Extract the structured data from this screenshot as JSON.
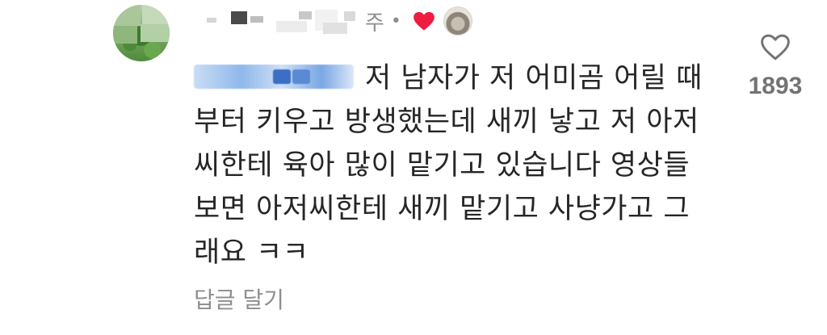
{
  "comment": {
    "timestamp": "주",
    "separator": "•",
    "body": "저 남자가 저 어미곰 어릴 때부터 키우고 방생했는데 새끼 낳고 저 아저씨한테 육아 많이 맡기고 있습니다 영상들 보면 아저씨한테 새끼 맡기고 사냥가고 그래요 ㅋㅋ",
    "reply_label": "답글 달기"
  },
  "likes": {
    "count": "1893"
  },
  "colors": {
    "liked_heart": "#ed1c40",
    "muted_text": "#8e8e8e",
    "body_text": "#262626"
  },
  "icons": {
    "liked": "heart-filled-icon",
    "like": "heart-outline-icon"
  }
}
